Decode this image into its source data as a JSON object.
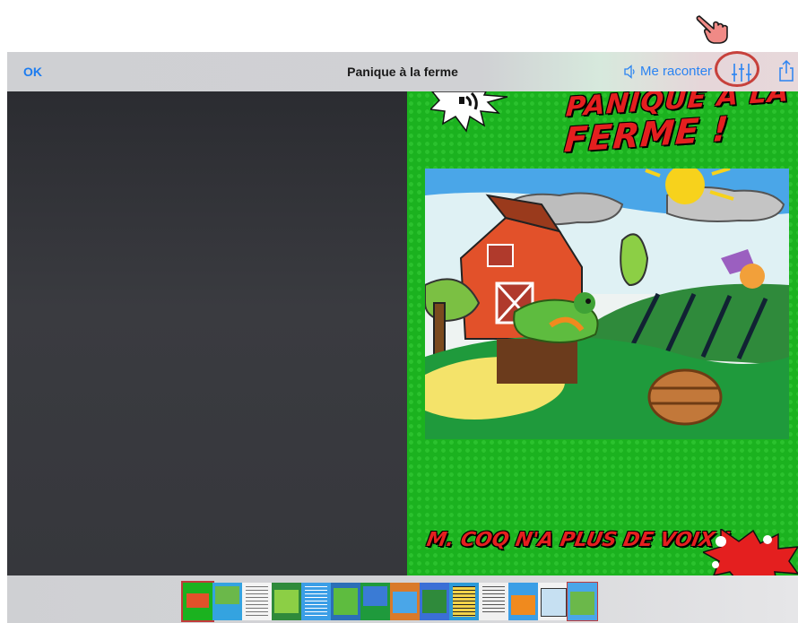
{
  "toolbar": {
    "ok_label": "OK",
    "title": "Panique à la ferme",
    "narrate_label": "Me raconter"
  },
  "page": {
    "title_line1": "PANIQUE À LA",
    "title_line2": "FERME !",
    "caption": "M. COQ N'A PLUS DE VOIX !"
  },
  "icons": {
    "speaker": "speaker-icon",
    "settings": "sliders-icon",
    "share": "share-icon",
    "pointer": "pointing-hand-icon"
  },
  "thumbnails": {
    "count": 14,
    "current_index": 0
  },
  "colors": {
    "accent": "#1c7cf0",
    "highlight_circle": "#c7413c",
    "page_green": "#1bb21f",
    "comic_red": "#e41f1f"
  }
}
